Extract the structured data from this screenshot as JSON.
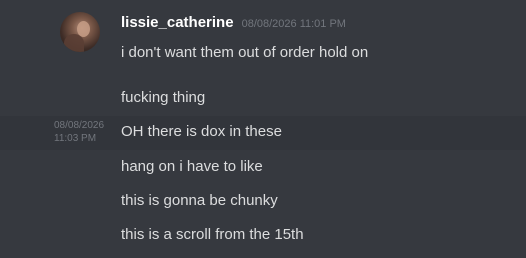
{
  "author": {
    "username": "lissie_catherine",
    "timestamp": "08/08/2026 11:01 PM"
  },
  "messages": [
    {
      "text": "i don't want them out of order hold on"
    },
    {
      "text": "fucking thing"
    },
    {
      "text": "OH there is dox in these",
      "side_date": "08/08/2026",
      "side_time": "11:03 PM"
    },
    {
      "text": "hang on i have to like"
    },
    {
      "text": "this is gonna be chunky"
    },
    {
      "text": "this is a scroll from the 15th"
    }
  ],
  "colors": {
    "background": "#36393f",
    "hover_row": "#32353b",
    "username": "#ffffff",
    "message_text": "#dcddde",
    "timestamp": "#72767d"
  }
}
